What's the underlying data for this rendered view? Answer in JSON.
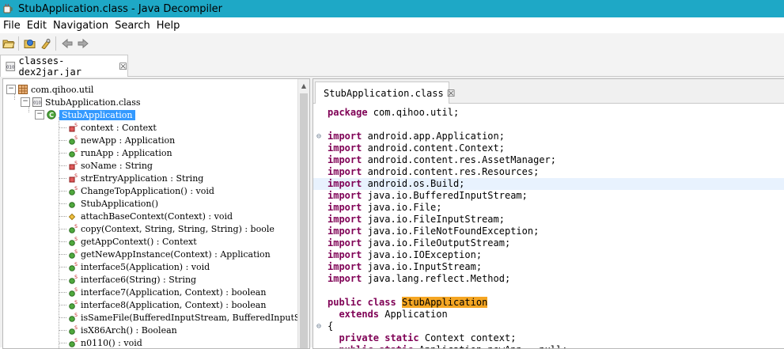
{
  "window": {
    "title": "StubApplication.class - Java Decompiler"
  },
  "menu": [
    "File",
    "Edit",
    "Navigation",
    "Search",
    "Help"
  ],
  "toolbar": {
    "icons": [
      "open-folder-icon",
      "open-type-icon",
      "search-icon",
      "back-arrow-icon",
      "forward-arrow-icon"
    ]
  },
  "file_tab": {
    "label": "classes-dex2jar.jar",
    "close": "☒"
  },
  "editor_tab": {
    "label": "StubApplication.class",
    "close": "☒"
  },
  "tree": {
    "package": "com.qihoo.util",
    "class_file": "StubApplication.class",
    "class": "StubApplication",
    "members": [
      {
        "label": "context : Context",
        "icon": "static-field-icon"
      },
      {
        "label": "newApp : Application",
        "icon": "public-static-field-icon"
      },
      {
        "label": "runApp : Application",
        "icon": "public-static-field-icon"
      },
      {
        "label": "soName : String",
        "icon": "static-field-icon"
      },
      {
        "label": "strEntryApplication : String",
        "icon": "static-field-icon"
      },
      {
        "label": "ChangeTopApplication() : void",
        "icon": "public-static-method-icon"
      },
      {
        "label": "StubApplication()",
        "icon": "public-method-icon"
      },
      {
        "label": "attachBaseContext(Context) : void",
        "icon": "protected-method-icon"
      },
      {
        "label": "copy(Context, String, String, String) : boole",
        "icon": "public-static-method-icon"
      },
      {
        "label": "getAppContext() : Context",
        "icon": "public-static-method-icon"
      },
      {
        "label": "getNewAppInstance(Context) : Application",
        "icon": "public-static-method-icon"
      },
      {
        "label": "interface5(Application) : void",
        "icon": "public-static-method-icon"
      },
      {
        "label": "interface6(String) : String",
        "icon": "public-static-method-icon"
      },
      {
        "label": "interface7(Application, Context) : boolean",
        "icon": "public-static-method-icon"
      },
      {
        "label": "interface8(Application, Context) : boolean",
        "icon": "public-static-method-icon"
      },
      {
        "label": "isSameFile(BufferedInputStream, BufferedInputS",
        "icon": "public-static-method-icon"
      },
      {
        "label": "isX86Arch() : Boolean",
        "icon": "public-static-method-icon"
      },
      {
        "label": "n0110() : void",
        "icon": "public-static-method-icon"
      }
    ]
  },
  "code": {
    "lines": [
      [
        {
          "t": "package",
          "k": 1
        },
        {
          "t": " com.qihoo.util;"
        }
      ],
      [],
      [
        {
          "t": "import",
          "k": 1
        },
        {
          "t": " android.app.Application;"
        }
      ],
      [
        {
          "t": "import",
          "k": 1
        },
        {
          "t": " android.content.Context;"
        }
      ],
      [
        {
          "t": "import",
          "k": 1
        },
        {
          "t": " android.content.res.AssetManager;"
        }
      ],
      [
        {
          "t": "import",
          "k": 1
        },
        {
          "t": " android.content.res.Resources;"
        }
      ],
      [
        {
          "t": "import",
          "k": 1
        },
        {
          "t": " android.os.Build;"
        }
      ],
      [
        {
          "t": "import",
          "k": 1
        },
        {
          "t": " java.io.BufferedInputStream;"
        }
      ],
      [
        {
          "t": "import",
          "k": 1
        },
        {
          "t": " java.io.File;"
        }
      ],
      [
        {
          "t": "import",
          "k": 1
        },
        {
          "t": " java.io.FileInputStream;"
        }
      ],
      [
        {
          "t": "import",
          "k": 1
        },
        {
          "t": " java.io.FileNotFoundException;"
        }
      ],
      [
        {
          "t": "import",
          "k": 1
        },
        {
          "t": " java.io.FileOutputStream;"
        }
      ],
      [
        {
          "t": "import",
          "k": 1
        },
        {
          "t": " java.io.IOException;"
        }
      ],
      [
        {
          "t": "import",
          "k": 1
        },
        {
          "t": " java.io.InputStream;"
        }
      ],
      [
        {
          "t": "import",
          "k": 1
        },
        {
          "t": " java.lang.reflect.Method;"
        }
      ],
      [],
      [
        {
          "t": "public",
          "k": 1
        },
        {
          "t": " "
        },
        {
          "t": "class",
          "k": 1
        },
        {
          "t": " "
        },
        {
          "t": "StubApplication",
          "h": 1
        }
      ],
      [
        {
          "t": "  "
        },
        {
          "t": "extends",
          "k": 1
        },
        {
          "t": " Application"
        }
      ],
      [
        {
          "t": "{"
        }
      ],
      [
        {
          "t": "  "
        },
        {
          "t": "private",
          "k": 1
        },
        {
          "t": " "
        },
        {
          "t": "static",
          "k": 1
        },
        {
          "t": " Context context;"
        }
      ],
      [
        {
          "t": "  "
        },
        {
          "t": "public",
          "k": 1
        },
        {
          "t": " "
        },
        {
          "t": "static",
          "k": 1
        },
        {
          "t": " Application newApp = null;"
        }
      ]
    ],
    "fold_markers": [
      "⊖",
      "⊖"
    ],
    "highlighted_line": 6
  }
}
